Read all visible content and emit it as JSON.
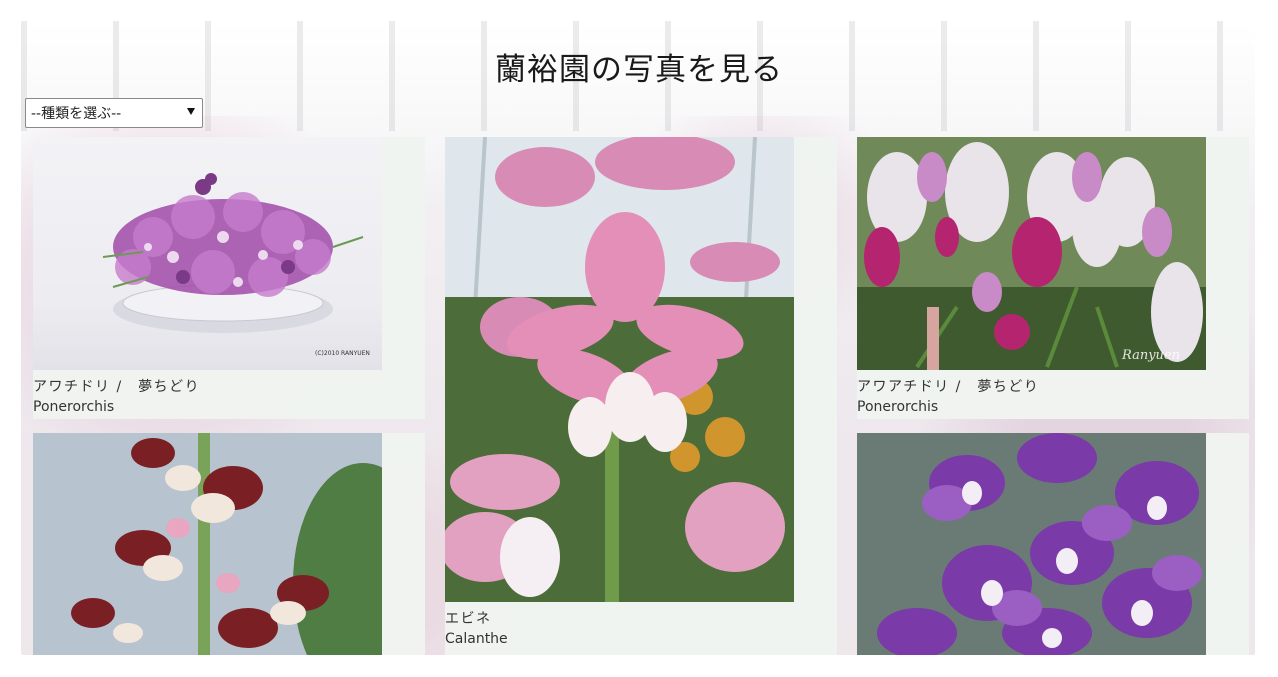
{
  "page": {
    "title": "蘭裕園の写真を見る",
    "select_value": "--種類を選ぶ--"
  },
  "cards": [
    {
      "name_ja": "アワチドリ /　夢ちどり",
      "name_en": "Ponerorchis",
      "watermark": "(C)2010 RANYUEN"
    },
    {
      "name_ja": "エビネ",
      "name_en": "Calanthe"
    },
    {
      "name_ja": "アワアチドリ /　夢ちどり",
      "name_en": "Ponerorchis",
      "watermark": "Ranyuen"
    },
    {
      "name_ja": "",
      "name_en": ""
    },
    {
      "name_ja": "",
      "name_en": ""
    }
  ],
  "colors": {
    "card_bg": "#eff4ef",
    "title_text": "#1a1a1a",
    "caption_text": "#333333"
  },
  "icons": {
    "select_arrow": "chevron-down-icon"
  }
}
